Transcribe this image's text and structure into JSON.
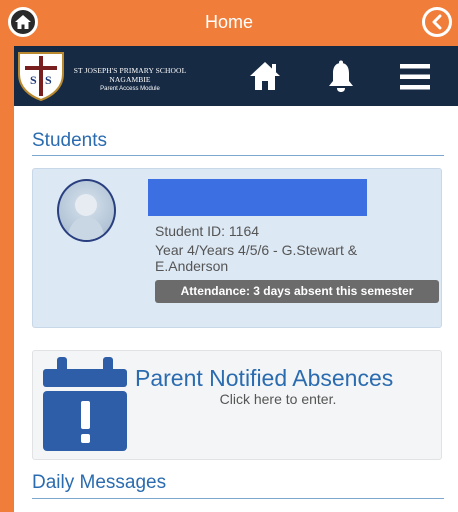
{
  "topbar": {
    "title": "Home",
    "home_icon": "home-circle-icon",
    "back_icon": "back-circle-icon"
  },
  "header": {
    "school_name_line1": "ST JOSEPH'S PRIMARY SCHOOL",
    "school_name_line2": "NAGAMBIE",
    "module_name": "Parent Access Module",
    "crest_letters": "SJS",
    "nav_icons": [
      "home-icon",
      "bell-icon",
      "menu-icon"
    ]
  },
  "students": {
    "title": "Students",
    "student": {
      "id_text": "Student ID: 1164",
      "year_text": "Year 4/Years 4/5/6 - G.Stewart & E.Anderson",
      "attendance": "Attendance: 3 days absent this semester"
    }
  },
  "absences": {
    "title": "Parent Notified Absences",
    "subtitle": "Click here to enter."
  },
  "daily_messages": {
    "title": "Daily Messages"
  },
  "colors": {
    "accent_orange": "#f07e3a",
    "header_navy": "#162a44",
    "link_blue": "#2b6cb0"
  }
}
